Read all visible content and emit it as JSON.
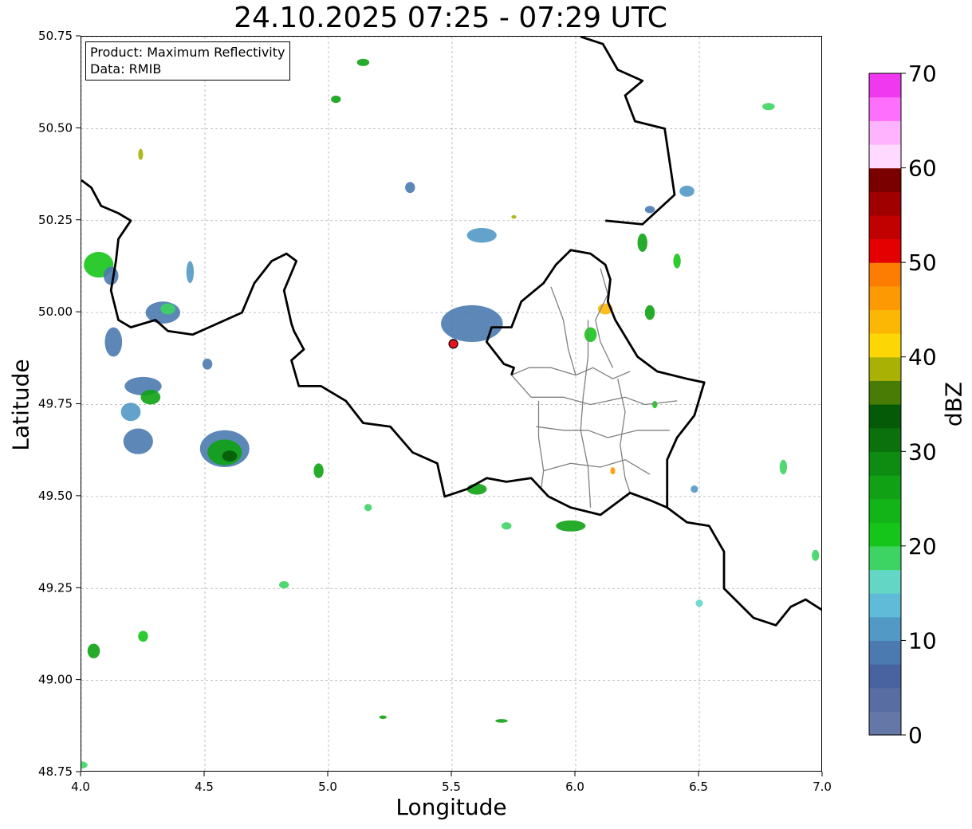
{
  "title": "24.10.2025 07:25 - 07:29 UTC",
  "info_box": {
    "product": "Product: Maximum Reflectivity",
    "data": "Data: RMIB"
  },
  "axes": {
    "xlabel": "Longitude",
    "ylabel": "Latitude",
    "xlim": [
      4.0,
      7.0
    ],
    "ylim": [
      48.75,
      50.75
    ],
    "xticks": [
      "4.0",
      "4.5",
      "5.0",
      "5.5",
      "6.0",
      "6.5",
      "7.0"
    ],
    "yticks": [
      "50.75",
      "50.50",
      "50.25",
      "50.00",
      "49.75",
      "49.50",
      "49.25",
      "49.00",
      "48.75"
    ],
    "grid": true
  },
  "radar_site": {
    "lon": 5.505,
    "lat": 49.915,
    "color": "#e8121b"
  },
  "colorbar": {
    "label": "dBZ",
    "range": [
      0,
      70
    ],
    "ticks": [
      "0",
      "10",
      "20",
      "30",
      "40",
      "50",
      "60",
      "70"
    ],
    "colors": [
      "#6477a6",
      "#586ea2",
      "#48639f",
      "#4a7aaf",
      "#5299c5",
      "#60bbd8",
      "#64d6c6",
      "#3ed464",
      "#16c51a",
      "#12b417",
      "#10a214",
      "#0e8c11",
      "#0a710c",
      "#055a08",
      "#487c04",
      "#a8b104",
      "#fdd705",
      "#fcb604",
      "#fd9a03",
      "#fd7c02",
      "#e40000",
      "#c10000",
      "#a00000",
      "#7a0000",
      "#ffd9ff",
      "#feb3fe",
      "#fe6ffe",
      "#f038f0"
    ]
  },
  "echoes": [
    {
      "lon": 4.07,
      "lat": 50.13,
      "w": 0.12,
      "h": 0.07,
      "c": "#16c51a"
    },
    {
      "lon": 4.12,
      "lat": 50.1,
      "w": 0.06,
      "h": 0.05,
      "c": "#4a7aaf"
    },
    {
      "lon": 4.33,
      "lat": 50.0,
      "w": 0.14,
      "h": 0.06,
      "c": "#4a7aaf"
    },
    {
      "lon": 4.35,
      "lat": 50.01,
      "w": 0.06,
      "h": 0.03,
      "c": "#3ed464"
    },
    {
      "lon": 4.13,
      "lat": 49.92,
      "w": 0.07,
      "h": 0.08,
      "c": "#4a7aaf"
    },
    {
      "lon": 4.25,
      "lat": 49.8,
      "w": 0.15,
      "h": 0.05,
      "c": "#4a7aaf"
    },
    {
      "lon": 4.28,
      "lat": 49.77,
      "w": 0.08,
      "h": 0.04,
      "c": "#10a214"
    },
    {
      "lon": 4.2,
      "lat": 49.73,
      "w": 0.08,
      "h": 0.05,
      "c": "#5299c5"
    },
    {
      "lon": 4.23,
      "lat": 49.65,
      "w": 0.12,
      "h": 0.07,
      "c": "#4a7aaf"
    },
    {
      "lon": 4.58,
      "lat": 49.63,
      "w": 0.2,
      "h": 0.1,
      "c": "#4a7aaf"
    },
    {
      "lon": 4.58,
      "lat": 49.62,
      "w": 0.14,
      "h": 0.07,
      "c": "#10a214"
    },
    {
      "lon": 4.6,
      "lat": 49.61,
      "w": 0.06,
      "h": 0.03,
      "c": "#055a08"
    },
    {
      "lon": 4.51,
      "lat": 49.86,
      "w": 0.04,
      "h": 0.03,
      "c": "#4a7aaf"
    },
    {
      "lon": 4.44,
      "lat": 50.11,
      "w": 0.03,
      "h": 0.06,
      "c": "#5299c5"
    },
    {
      "lon": 5.58,
      "lat": 49.97,
      "w": 0.25,
      "h": 0.1,
      "c": "#4a7aaf"
    },
    {
      "lon": 5.62,
      "lat": 50.21,
      "w": 0.12,
      "h": 0.04,
      "c": "#5299c5"
    },
    {
      "lon": 5.75,
      "lat": 50.26,
      "w": 0.02,
      "h": 0.01,
      "c": "#a8b104"
    },
    {
      "lon": 6.06,
      "lat": 49.94,
      "w": 0.05,
      "h": 0.04,
      "c": "#16c51a"
    },
    {
      "lon": 6.12,
      "lat": 50.01,
      "w": 0.06,
      "h": 0.03,
      "c": "#fcb604"
    },
    {
      "lon": 6.41,
      "lat": 50.14,
      "w": 0.03,
      "h": 0.04,
      "c": "#16c51a"
    },
    {
      "lon": 6.45,
      "lat": 50.33,
      "w": 0.06,
      "h": 0.03,
      "c": "#5299c5"
    },
    {
      "lon": 6.27,
      "lat": 50.19,
      "w": 0.04,
      "h": 0.05,
      "c": "#10a214"
    },
    {
      "lon": 6.3,
      "lat": 50.0,
      "w": 0.04,
      "h": 0.04,
      "c": "#10a214"
    },
    {
      "lon": 6.32,
      "lat": 49.75,
      "w": 0.02,
      "h": 0.02,
      "c": "#16c51a"
    },
    {
      "lon": 5.98,
      "lat": 49.42,
      "w": 0.12,
      "h": 0.03,
      "c": "#10a214"
    },
    {
      "lon": 5.14,
      "lat": 50.68,
      "w": 0.05,
      "h": 0.02,
      "c": "#10a214"
    },
    {
      "lon": 5.03,
      "lat": 50.58,
      "w": 0.04,
      "h": 0.02,
      "c": "#10a214"
    },
    {
      "lon": 4.24,
      "lat": 50.43,
      "w": 0.02,
      "h": 0.03,
      "c": "#a8b104"
    },
    {
      "lon": 4.25,
      "lat": 49.12,
      "w": 0.04,
      "h": 0.03,
      "c": "#16c51a"
    },
    {
      "lon": 4.05,
      "lat": 49.08,
      "w": 0.05,
      "h": 0.04,
      "c": "#10a214"
    },
    {
      "lon": 4.0,
      "lat": 48.77,
      "w": 0.05,
      "h": 0.02,
      "c": "#3ed464"
    },
    {
      "lon": 6.84,
      "lat": 49.58,
      "w": 0.03,
      "h": 0.04,
      "c": "#3ed464"
    },
    {
      "lon": 6.97,
      "lat": 49.34,
      "w": 0.03,
      "h": 0.03,
      "c": "#3ed464"
    },
    {
      "lon": 6.78,
      "lat": 50.56,
      "w": 0.05,
      "h": 0.02,
      "c": "#3ed464"
    },
    {
      "lon": 5.33,
      "lat": 50.34,
      "w": 0.04,
      "h": 0.03,
      "c": "#4a7aaf"
    },
    {
      "lon": 5.6,
      "lat": 49.52,
      "w": 0.08,
      "h": 0.03,
      "c": "#10a214"
    },
    {
      "lon": 4.96,
      "lat": 49.57,
      "w": 0.04,
      "h": 0.04,
      "c": "#10a214"
    },
    {
      "lon": 5.16,
      "lat": 49.47,
      "w": 0.03,
      "h": 0.02,
      "c": "#3ed464"
    },
    {
      "lon": 5.72,
      "lat": 49.42,
      "w": 0.04,
      "h": 0.02,
      "c": "#3ed464"
    },
    {
      "lon": 6.48,
      "lat": 49.52,
      "w": 0.03,
      "h": 0.02,
      "c": "#5299c5"
    },
    {
      "lon": 6.5,
      "lat": 49.21,
      "w": 0.03,
      "h": 0.02,
      "c": "#64d6c6"
    },
    {
      "lon": 6.15,
      "lat": 49.57,
      "w": 0.02,
      "h": 0.02,
      "c": "#fd9a03"
    },
    {
      "lon": 5.22,
      "lat": 48.9,
      "w": 0.03,
      "h": 0.01,
      "c": "#10a214"
    },
    {
      "lon": 5.7,
      "lat": 48.89,
      "w": 0.05,
      "h": 0.01,
      "c": "#10a214"
    },
    {
      "lon": 6.3,
      "lat": 50.28,
      "w": 0.04,
      "h": 0.02,
      "c": "#4a7aaf"
    },
    {
      "lon": 4.82,
      "lat": 49.26,
      "w": 0.04,
      "h": 0.02,
      "c": "#3ed464"
    }
  ],
  "borders": {
    "black": [
      [
        [
          4.0,
          50.36
        ],
        [
          4.04,
          50.34
        ],
        [
          4.08,
          50.29
        ],
        [
          4.15,
          50.27
        ],
        [
          4.2,
          50.25
        ],
        [
          4.15,
          50.2
        ],
        [
          4.14,
          50.14
        ],
        [
          4.12,
          50.06
        ],
        [
          4.15,
          49.98
        ],
        [
          4.2,
          49.96
        ],
        [
          4.3,
          49.98
        ],
        [
          4.35,
          49.95
        ],
        [
          4.45,
          49.94
        ],
        [
          4.55,
          49.97
        ],
        [
          4.65,
          50.0
        ],
        [
          4.7,
          50.08
        ],
        [
          4.77,
          50.14
        ],
        [
          4.83,
          50.16
        ],
        [
          4.87,
          50.14
        ],
        [
          4.82,
          50.06
        ],
        [
          4.85,
          49.97
        ],
        [
          4.86,
          49.95
        ],
        [
          4.9,
          49.9
        ],
        [
          4.85,
          49.87
        ],
        [
          4.88,
          49.8
        ],
        [
          4.97,
          49.8
        ],
        [
          5.07,
          49.76
        ],
        [
          5.14,
          49.7
        ],
        [
          5.25,
          49.69
        ],
        [
          5.34,
          49.62
        ],
        [
          5.44,
          49.59
        ],
        [
          5.47,
          49.5
        ],
        [
          5.56,
          49.52
        ],
        [
          5.64,
          49.55
        ],
        [
          5.72,
          49.54
        ],
        [
          5.82,
          49.55
        ],
        [
          5.89,
          49.5
        ],
        [
          5.98,
          49.47
        ],
        [
          6.1,
          49.45
        ],
        [
          6.22,
          49.51
        ],
        [
          6.3,
          49.49
        ],
        [
          6.37,
          49.47
        ],
        [
          6.45,
          49.43
        ],
        [
          6.54,
          49.42
        ],
        [
          6.6,
          49.35
        ],
        [
          6.6,
          49.25
        ],
        [
          6.72,
          49.17
        ],
        [
          6.81,
          49.15
        ],
        [
          6.87,
          49.2
        ],
        [
          6.93,
          49.22
        ],
        [
          7.0,
          49.19
        ]
      ],
      [
        [
          6.12,
          50.25
        ],
        [
          6.27,
          50.24
        ],
        [
          6.4,
          50.32
        ],
        [
          6.36,
          50.5
        ],
        [
          6.24,
          50.52
        ],
        [
          6.2,
          50.59
        ],
        [
          6.27,
          50.63
        ],
        [
          6.17,
          50.66
        ],
        [
          6.11,
          50.73
        ],
        [
          6.02,
          50.75
        ]
      ],
      [
        [
          5.74,
          49.83
        ],
        [
          5.75,
          49.85
        ],
        [
          5.71,
          49.86
        ],
        [
          5.64,
          49.92
        ],
        [
          5.66,
          49.96
        ],
        [
          5.74,
          49.96
        ],
        [
          5.78,
          50.03
        ],
        [
          5.87,
          50.08
        ],
        [
          5.92,
          50.13
        ],
        [
          5.98,
          50.17
        ],
        [
          6.06,
          50.16
        ],
        [
          6.12,
          50.13
        ],
        [
          6.14,
          50.09
        ],
        [
          6.13,
          50.03
        ],
        [
          6.16,
          49.98
        ],
        [
          6.25,
          49.88
        ],
        [
          6.33,
          49.84
        ],
        [
          6.45,
          49.82
        ],
        [
          6.52,
          49.81
        ],
        [
          6.48,
          49.72
        ],
        [
          6.41,
          49.66
        ],
        [
          6.37,
          49.6
        ],
        [
          6.37,
          49.47
        ]
      ]
    ],
    "gray": [
      [
        [
          5.74,
          49.83
        ],
        [
          5.81,
          49.85
        ],
        [
          5.9,
          49.85
        ],
        [
          6.0,
          49.83
        ],
        [
          6.07,
          49.85
        ],
        [
          6.15,
          49.82
        ],
        [
          6.22,
          49.84
        ]
      ],
      [
        [
          5.74,
          49.83
        ],
        [
          5.82,
          49.77
        ],
        [
          5.95,
          49.77
        ],
        [
          6.06,
          49.75
        ],
        [
          6.2,
          49.77
        ],
        [
          6.28,
          49.75
        ],
        [
          6.41,
          49.76
        ]
      ],
      [
        [
          5.84,
          49.69
        ],
        [
          5.95,
          49.68
        ],
        [
          6.05,
          49.68
        ],
        [
          6.13,
          49.66
        ],
        [
          6.25,
          49.68
        ],
        [
          6.38,
          49.68
        ]
      ],
      [
        [
          5.87,
          49.57
        ],
        [
          5.98,
          49.59
        ],
        [
          6.1,
          49.58
        ],
        [
          6.2,
          49.6
        ],
        [
          6.3,
          49.56
        ]
      ],
      [
        [
          5.85,
          49.76
        ],
        [
          5.85,
          49.66
        ],
        [
          5.87,
          49.57
        ],
        [
          5.86,
          49.52
        ]
      ],
      [
        [
          6.05,
          49.98
        ],
        [
          6.05,
          49.88
        ],
        [
          6.03,
          49.77
        ],
        [
          6.02,
          49.68
        ],
        [
          6.05,
          49.58
        ],
        [
          6.06,
          49.47
        ]
      ],
      [
        [
          6.17,
          49.82
        ],
        [
          6.2,
          49.73
        ],
        [
          6.18,
          49.64
        ],
        [
          6.2,
          49.55
        ],
        [
          6.22,
          49.51
        ]
      ],
      [
        [
          5.9,
          50.07
        ],
        [
          5.95,
          49.98
        ],
        [
          5.97,
          49.9
        ],
        [
          6.0,
          49.83
        ]
      ],
      [
        [
          6.1,
          50.12
        ],
        [
          6.13,
          50.05
        ],
        [
          6.08,
          49.98
        ],
        [
          6.1,
          49.92
        ],
        [
          6.15,
          49.85
        ]
      ]
    ]
  }
}
